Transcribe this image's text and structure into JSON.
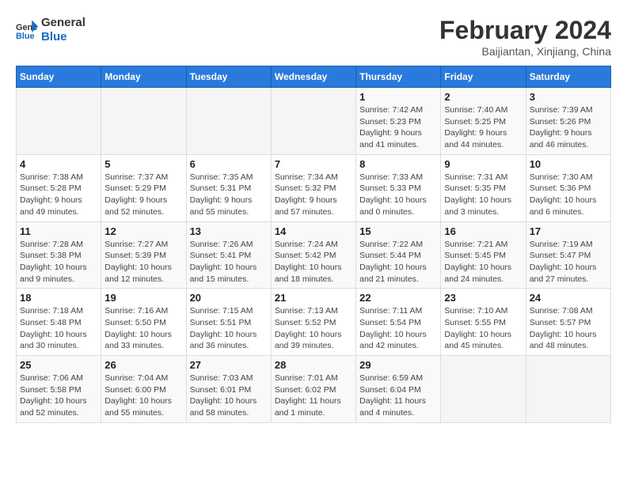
{
  "header": {
    "logo_line1": "General",
    "logo_line2": "Blue",
    "month": "February 2024",
    "location": "Baijiantan, Xinjiang, China"
  },
  "weekdays": [
    "Sunday",
    "Monday",
    "Tuesday",
    "Wednesday",
    "Thursday",
    "Friday",
    "Saturday"
  ],
  "weeks": [
    [
      {
        "day": "",
        "sunrise": "",
        "sunset": "",
        "daylight": ""
      },
      {
        "day": "",
        "sunrise": "",
        "sunset": "",
        "daylight": ""
      },
      {
        "day": "",
        "sunrise": "",
        "sunset": "",
        "daylight": ""
      },
      {
        "day": "",
        "sunrise": "",
        "sunset": "",
        "daylight": ""
      },
      {
        "day": "1",
        "sunrise": "Sunrise: 7:42 AM",
        "sunset": "Sunset: 5:23 PM",
        "daylight": "Daylight: 9 hours and 41 minutes."
      },
      {
        "day": "2",
        "sunrise": "Sunrise: 7:40 AM",
        "sunset": "Sunset: 5:25 PM",
        "daylight": "Daylight: 9 hours and 44 minutes."
      },
      {
        "day": "3",
        "sunrise": "Sunrise: 7:39 AM",
        "sunset": "Sunset: 5:26 PM",
        "daylight": "Daylight: 9 hours and 46 minutes."
      }
    ],
    [
      {
        "day": "4",
        "sunrise": "Sunrise: 7:38 AM",
        "sunset": "Sunset: 5:28 PM",
        "daylight": "Daylight: 9 hours and 49 minutes."
      },
      {
        "day": "5",
        "sunrise": "Sunrise: 7:37 AM",
        "sunset": "Sunset: 5:29 PM",
        "daylight": "Daylight: 9 hours and 52 minutes."
      },
      {
        "day": "6",
        "sunrise": "Sunrise: 7:35 AM",
        "sunset": "Sunset: 5:31 PM",
        "daylight": "Daylight: 9 hours and 55 minutes."
      },
      {
        "day": "7",
        "sunrise": "Sunrise: 7:34 AM",
        "sunset": "Sunset: 5:32 PM",
        "daylight": "Daylight: 9 hours and 57 minutes."
      },
      {
        "day": "8",
        "sunrise": "Sunrise: 7:33 AM",
        "sunset": "Sunset: 5:33 PM",
        "daylight": "Daylight: 10 hours and 0 minutes."
      },
      {
        "day": "9",
        "sunrise": "Sunrise: 7:31 AM",
        "sunset": "Sunset: 5:35 PM",
        "daylight": "Daylight: 10 hours and 3 minutes."
      },
      {
        "day": "10",
        "sunrise": "Sunrise: 7:30 AM",
        "sunset": "Sunset: 5:36 PM",
        "daylight": "Daylight: 10 hours and 6 minutes."
      }
    ],
    [
      {
        "day": "11",
        "sunrise": "Sunrise: 7:28 AM",
        "sunset": "Sunset: 5:38 PM",
        "daylight": "Daylight: 10 hours and 9 minutes."
      },
      {
        "day": "12",
        "sunrise": "Sunrise: 7:27 AM",
        "sunset": "Sunset: 5:39 PM",
        "daylight": "Daylight: 10 hours and 12 minutes."
      },
      {
        "day": "13",
        "sunrise": "Sunrise: 7:26 AM",
        "sunset": "Sunset: 5:41 PM",
        "daylight": "Daylight: 10 hours and 15 minutes."
      },
      {
        "day": "14",
        "sunrise": "Sunrise: 7:24 AM",
        "sunset": "Sunset: 5:42 PM",
        "daylight": "Daylight: 10 hours and 18 minutes."
      },
      {
        "day": "15",
        "sunrise": "Sunrise: 7:22 AM",
        "sunset": "Sunset: 5:44 PM",
        "daylight": "Daylight: 10 hours and 21 minutes."
      },
      {
        "day": "16",
        "sunrise": "Sunrise: 7:21 AM",
        "sunset": "Sunset: 5:45 PM",
        "daylight": "Daylight: 10 hours and 24 minutes."
      },
      {
        "day": "17",
        "sunrise": "Sunrise: 7:19 AM",
        "sunset": "Sunset: 5:47 PM",
        "daylight": "Daylight: 10 hours and 27 minutes."
      }
    ],
    [
      {
        "day": "18",
        "sunrise": "Sunrise: 7:18 AM",
        "sunset": "Sunset: 5:48 PM",
        "daylight": "Daylight: 10 hours and 30 minutes."
      },
      {
        "day": "19",
        "sunrise": "Sunrise: 7:16 AM",
        "sunset": "Sunset: 5:50 PM",
        "daylight": "Daylight: 10 hours and 33 minutes."
      },
      {
        "day": "20",
        "sunrise": "Sunrise: 7:15 AM",
        "sunset": "Sunset: 5:51 PM",
        "daylight": "Daylight: 10 hours and 36 minutes."
      },
      {
        "day": "21",
        "sunrise": "Sunrise: 7:13 AM",
        "sunset": "Sunset: 5:52 PM",
        "daylight": "Daylight: 10 hours and 39 minutes."
      },
      {
        "day": "22",
        "sunrise": "Sunrise: 7:11 AM",
        "sunset": "Sunset: 5:54 PM",
        "daylight": "Daylight: 10 hours and 42 minutes."
      },
      {
        "day": "23",
        "sunrise": "Sunrise: 7:10 AM",
        "sunset": "Sunset: 5:55 PM",
        "daylight": "Daylight: 10 hours and 45 minutes."
      },
      {
        "day": "24",
        "sunrise": "Sunrise: 7:08 AM",
        "sunset": "Sunset: 5:57 PM",
        "daylight": "Daylight: 10 hours and 48 minutes."
      }
    ],
    [
      {
        "day": "25",
        "sunrise": "Sunrise: 7:06 AM",
        "sunset": "Sunset: 5:58 PM",
        "daylight": "Daylight: 10 hours and 52 minutes."
      },
      {
        "day": "26",
        "sunrise": "Sunrise: 7:04 AM",
        "sunset": "Sunset: 6:00 PM",
        "daylight": "Daylight: 10 hours and 55 minutes."
      },
      {
        "day": "27",
        "sunrise": "Sunrise: 7:03 AM",
        "sunset": "Sunset: 6:01 PM",
        "daylight": "Daylight: 10 hours and 58 minutes."
      },
      {
        "day": "28",
        "sunrise": "Sunrise: 7:01 AM",
        "sunset": "Sunset: 6:02 PM",
        "daylight": "Daylight: 11 hours and 1 minute."
      },
      {
        "day": "29",
        "sunrise": "Sunrise: 6:59 AM",
        "sunset": "Sunset: 6:04 PM",
        "daylight": "Daylight: 11 hours and 4 minutes."
      },
      {
        "day": "",
        "sunrise": "",
        "sunset": "",
        "daylight": ""
      },
      {
        "day": "",
        "sunrise": "",
        "sunset": "",
        "daylight": ""
      }
    ]
  ]
}
